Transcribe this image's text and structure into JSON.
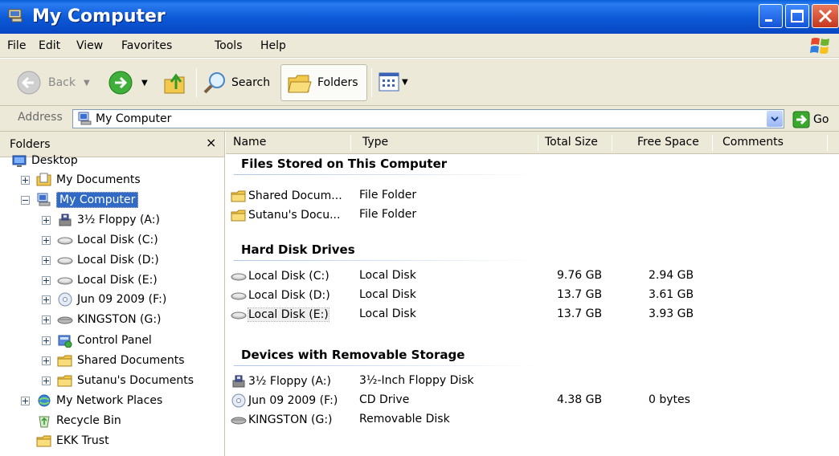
{
  "window": {
    "title": "My Computer"
  },
  "menu": [
    "File",
    "Edit",
    "View",
    "Favorites",
    "Tools",
    "Help"
  ],
  "toolbar": {
    "back_label": "Back",
    "search_label": "Search",
    "folders_label": "Folders"
  },
  "address": {
    "label": "Address",
    "value": "My Computer",
    "go_label": "Go"
  },
  "folder_pane": {
    "title": "Folders",
    "close_glyph": "×",
    "items": [
      {
        "label": "Desktop",
        "icon": "desktop-icon",
        "expander": "none"
      },
      {
        "label": "My Documents",
        "icon": "my-documents-icon",
        "expander": "plus"
      },
      {
        "label": "My Computer",
        "icon": "my-computer-icon",
        "expander": "minus",
        "selected": true
      },
      {
        "label": "3½ Floppy (A:)",
        "icon": "floppy-icon",
        "expander": "plus"
      },
      {
        "label": "Local Disk (C:)",
        "icon": "hard-disk-icon",
        "expander": "plus"
      },
      {
        "label": "Local Disk (D:)",
        "icon": "hard-disk-icon",
        "expander": "plus"
      },
      {
        "label": "Local Disk (E:)",
        "icon": "hard-disk-icon",
        "expander": "plus"
      },
      {
        "label": "Jun 09 2009 (F:)",
        "icon": "cd-drive-icon",
        "expander": "plus"
      },
      {
        "label": "KINGSTON (G:)",
        "icon": "removable-disk-icon",
        "expander": "plus"
      },
      {
        "label": "Control Panel",
        "icon": "control-panel-icon",
        "expander": "plus"
      },
      {
        "label": "Shared Documents",
        "icon": "folder-icon",
        "expander": "plus"
      },
      {
        "label": "Sutanu's Documents",
        "icon": "folder-icon",
        "expander": "plus"
      },
      {
        "label": "My Network Places",
        "icon": "network-places-icon",
        "expander": "plus"
      },
      {
        "label": "Recycle Bin",
        "icon": "recycle-bin-icon",
        "expander": "none"
      },
      {
        "label": "EKK Trust",
        "icon": "folder-icon",
        "expander": "none"
      }
    ]
  },
  "columns": {
    "name": "Name",
    "type": "Type",
    "total_size": "Total Size",
    "free_space": "Free Space",
    "comments": "Comments"
  },
  "groups": [
    {
      "title": "Files Stored on This Computer",
      "items": [
        {
          "name": "Shared Docum...",
          "type": "File Folder",
          "total": "",
          "free": "",
          "icon": "folder-icon"
        },
        {
          "name": "Sutanu's Docu...",
          "type": "File Folder",
          "total": "",
          "free": "",
          "icon": "folder-icon"
        }
      ]
    },
    {
      "title": "Hard Disk Drives",
      "items": [
        {
          "name": "Local Disk (C:)",
          "type": "Local Disk",
          "total": "9.76 GB",
          "free": "2.94 GB",
          "icon": "hard-disk-icon"
        },
        {
          "name": "Local Disk (D:)",
          "type": "Local Disk",
          "total": "13.7 GB",
          "free": "3.61 GB",
          "icon": "hard-disk-icon"
        },
        {
          "name": "Local Disk (E:)",
          "type": "Local Disk",
          "total": "13.7 GB",
          "free": "3.93 GB",
          "icon": "hard-disk-icon",
          "focused": true
        }
      ]
    },
    {
      "title": "Devices with Removable Storage",
      "items": [
        {
          "name": "3½ Floppy (A:)",
          "type": "3½-Inch Floppy Disk",
          "total": "",
          "free": "",
          "icon": "floppy-icon"
        },
        {
          "name": "Jun 09 2009 (F:)",
          "type": "CD Drive",
          "total": "4.38 GB",
          "free": "0 bytes",
          "icon": "cd-drive-icon"
        },
        {
          "name": "KINGSTON (G:)",
          "type": "Removable Disk",
          "total": "",
          "free": "",
          "icon": "removable-disk-icon"
        }
      ]
    }
  ]
}
